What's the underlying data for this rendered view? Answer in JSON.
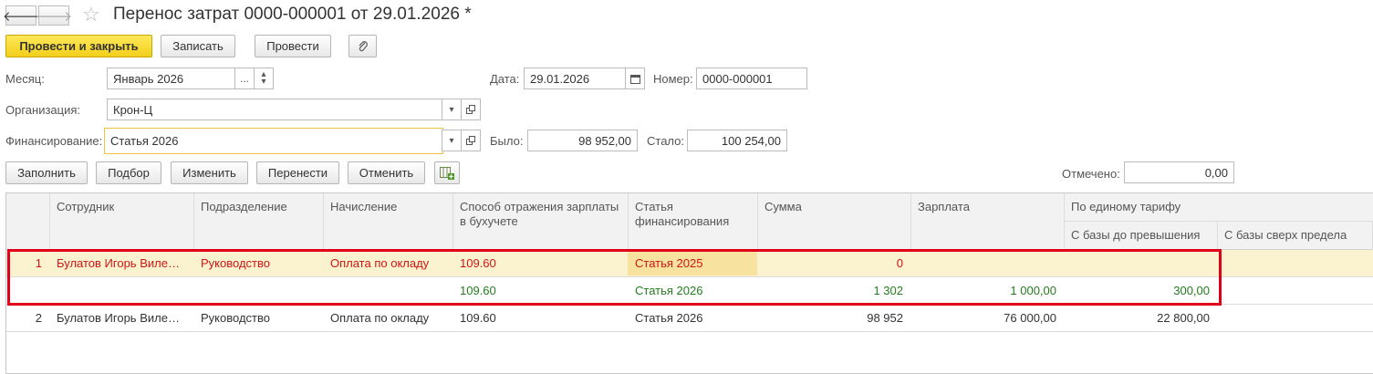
{
  "window": {
    "title": "Перенос затрат 0000-000001 от 29.01.2026 *"
  },
  "toolbar": {
    "post_close": "Провести и закрыть",
    "save": "Записать",
    "post": "Провести"
  },
  "form": {
    "month_label": "Месяц:",
    "month_value": "Январь 2026",
    "date_label": "Дата:",
    "date_value": "29.01.2026",
    "number_label": "Номер:",
    "number_value": "0000-000001",
    "org_label": "Организация:",
    "org_value": "Крон-Ц",
    "fin_label": "Финансирование:",
    "fin_value": "Статья 2026",
    "was_label": "Было:",
    "was_value": "98 952,00",
    "became_label": "Стало:",
    "became_value": "100 254,00",
    "marked_label": "Отмечено:",
    "marked_value": "0,00",
    "ellipsis": "...",
    "dropdown_glyph": "▾"
  },
  "table_toolbar": {
    "fill": "Заполнить",
    "select": "Подбор",
    "change": "Изменить",
    "transfer": "Перенести",
    "cancel": "Отменить"
  },
  "table": {
    "headers": {
      "employee": "Сотрудник",
      "department": "Подразделение",
      "accrual": "Начисление",
      "reflection_1": "Способ отражения зарплаты",
      "reflection_2": "в бухучете",
      "article_1": "Статья",
      "article_2": "финансирования",
      "sum": "Сумма",
      "salary": "Зарплата",
      "tariff": "По единому тарифу",
      "tariff_base": "С базы до превышения",
      "tariff_over": "С базы сверх предела"
    },
    "rows": [
      {
        "n": "1",
        "employee": "Булатов Игорь Виле…",
        "department": "Руководство",
        "accrual": "Оплата по окладу",
        "reflection": "109.60",
        "article": "Статья 2025",
        "sum": "0",
        "salary": "",
        "tariff_base": ""
      },
      {
        "n": "",
        "employee": "",
        "department": "",
        "accrual": "",
        "reflection": "109.60",
        "article": "Статья 2026",
        "sum": "1 302",
        "salary": "1 000,00",
        "tariff_base": "300,00"
      },
      {
        "n": "2",
        "employee": "Булатов Игорь Виле…",
        "department": "Руководство",
        "accrual": "Оплата по окладу",
        "reflection": "109.60",
        "article": "Статья 2026",
        "sum": "98 952",
        "salary": "76 000,00",
        "tariff_base": "22 800,00"
      }
    ]
  },
  "colors": {
    "primary": "#f2cf1a",
    "selected_row": "#fbf3d0",
    "highlight_border": "#e0001a",
    "red_text": "#d21414",
    "green_text": "#237c1e"
  }
}
